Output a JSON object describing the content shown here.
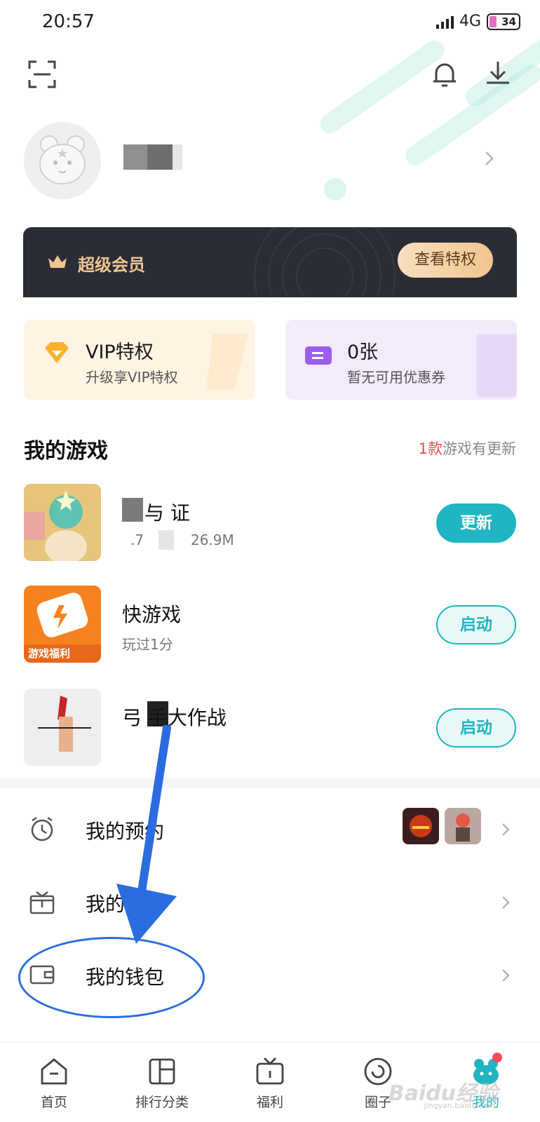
{
  "status_bar": {
    "time": "20:57",
    "network": "4G",
    "battery": "34"
  },
  "header": {
    "scan_icon": "scan-icon",
    "bell_icon": "bell-icon",
    "download_icon": "download-icon"
  },
  "profile": {
    "username": "",
    "avatar": "mascot-avatar"
  },
  "vip_banner": {
    "title": "超级会员",
    "button": "查看特权",
    "accent": "#f1c48f"
  },
  "cards": [
    {
      "title": "VIP特权",
      "subtitle": "升级享VIP特权"
    },
    {
      "title": "0张",
      "subtitle": "暂无可用优惠券"
    }
  ],
  "my_games": {
    "title": "我的游戏",
    "update_count": "1款",
    "update_text": "游戏有更新",
    "games": [
      {
        "name": "与  证",
        "meta_left": ".7",
        "meta_right": "26.9M",
        "button": "更新"
      },
      {
        "name": "快游戏",
        "meta": "玩过1分",
        "thumb_text": "游戏福利",
        "button": "启动"
      },
      {
        "name": "弓  手大作战",
        "button": "启动"
      }
    ]
  },
  "menu": [
    {
      "label": "我的预约",
      "icon": "alarm-clock-icon"
    },
    {
      "label": "我的礼包",
      "icon": "gift-box-icon"
    },
    {
      "label": "我的钱包",
      "icon": "wallet-icon"
    }
  ],
  "bottom_nav": [
    {
      "label": "首页",
      "icon": "home-icon"
    },
    {
      "label": "排行分类",
      "icon": "ranking-icon"
    },
    {
      "label": "福利",
      "icon": "welfare-tv-icon"
    },
    {
      "label": "圈子",
      "icon": "circle-community-icon"
    },
    {
      "label": "我的",
      "icon": "profile-mascot-icon",
      "active": true
    }
  ],
  "watermark": {
    "brand": "Baidu经验",
    "url": "jingyan.baidu.com"
  },
  "colors": {
    "primary": "#1fb5c3",
    "alert": "#e34b4b",
    "annotation": "#2b6de0"
  }
}
